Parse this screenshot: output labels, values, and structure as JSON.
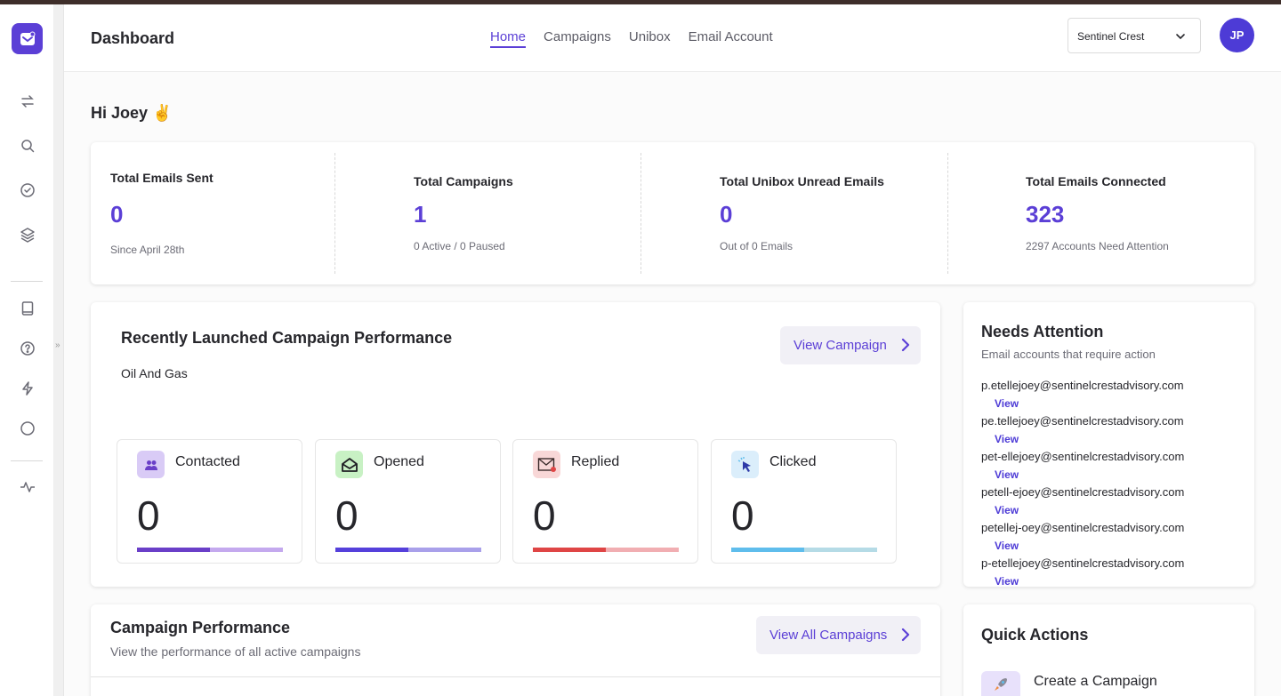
{
  "header": {
    "title": "Dashboard",
    "nav": [
      "Home",
      "Campaigns",
      "Unibox",
      "Email Account"
    ],
    "workspace": "Sentinel Crest",
    "avatar_initials": "JP"
  },
  "greeting": "Hi Joey ✌️",
  "stats": [
    {
      "label": "Total Emails Sent",
      "value": "0",
      "sub": "Since April 28th"
    },
    {
      "label": "Total Campaigns",
      "value": "1",
      "sub": "0 Active / 0 Paused"
    },
    {
      "label": "Total Unibox Unread Emails",
      "value": "0",
      "sub": "Out of 0 Emails"
    },
    {
      "label": "Total Emails Connected",
      "value": "323",
      "sub": "2297 Accounts Need Attention"
    }
  ],
  "recent": {
    "title": "Recently Launched Campaign Performance",
    "campaign_name": "Oil And Gas",
    "button": "View Campaign",
    "metrics": [
      {
        "label": "Contacted",
        "value": "0",
        "icon": "contacts-icon",
        "bar_colors": [
          "#6a3fc8",
          "#c4a9ee"
        ]
      },
      {
        "label": "Opened",
        "value": "0",
        "icon": "envelope-open-icon",
        "bar_colors": [
          "#5540db",
          "#a9a0ea"
        ]
      },
      {
        "label": "Replied",
        "value": "0",
        "icon": "envelope-reply-icon",
        "bar_colors": [
          "#df4545",
          "#f1aeb2"
        ]
      },
      {
        "label": "Clicked",
        "value": "0",
        "icon": "cursor-click-icon",
        "bar_colors": [
          "#5fbdec",
          "#b5dbe6"
        ]
      }
    ]
  },
  "attention": {
    "title": "Needs Attention",
    "subtitle": "Email accounts that require action",
    "view_label": "View",
    "items": [
      "p.etellejoey@sentinelcrestadvisory.com",
      "pe.tellejoey@sentinelcrestadvisory.com",
      "pet-ellejoey@sentinelcrestadvisory.com",
      "petell-ejoey@sentinelcrestadvisory.com",
      "petellej-oey@sentinelcrestadvisory.com",
      "p-etellejoey@sentinelcrestadvisory.com"
    ]
  },
  "performance": {
    "title": "Campaign Performance",
    "subtitle": "View the performance of all active campaigns",
    "button": "View All Campaigns"
  },
  "quick_actions": {
    "title": "Quick Actions",
    "items": [
      "Create a Campaign"
    ]
  },
  "colors": {
    "accent": "#5b3fd6",
    "avatar": "#4d3bd6",
    "top_strip": "#3e2e2a"
  }
}
